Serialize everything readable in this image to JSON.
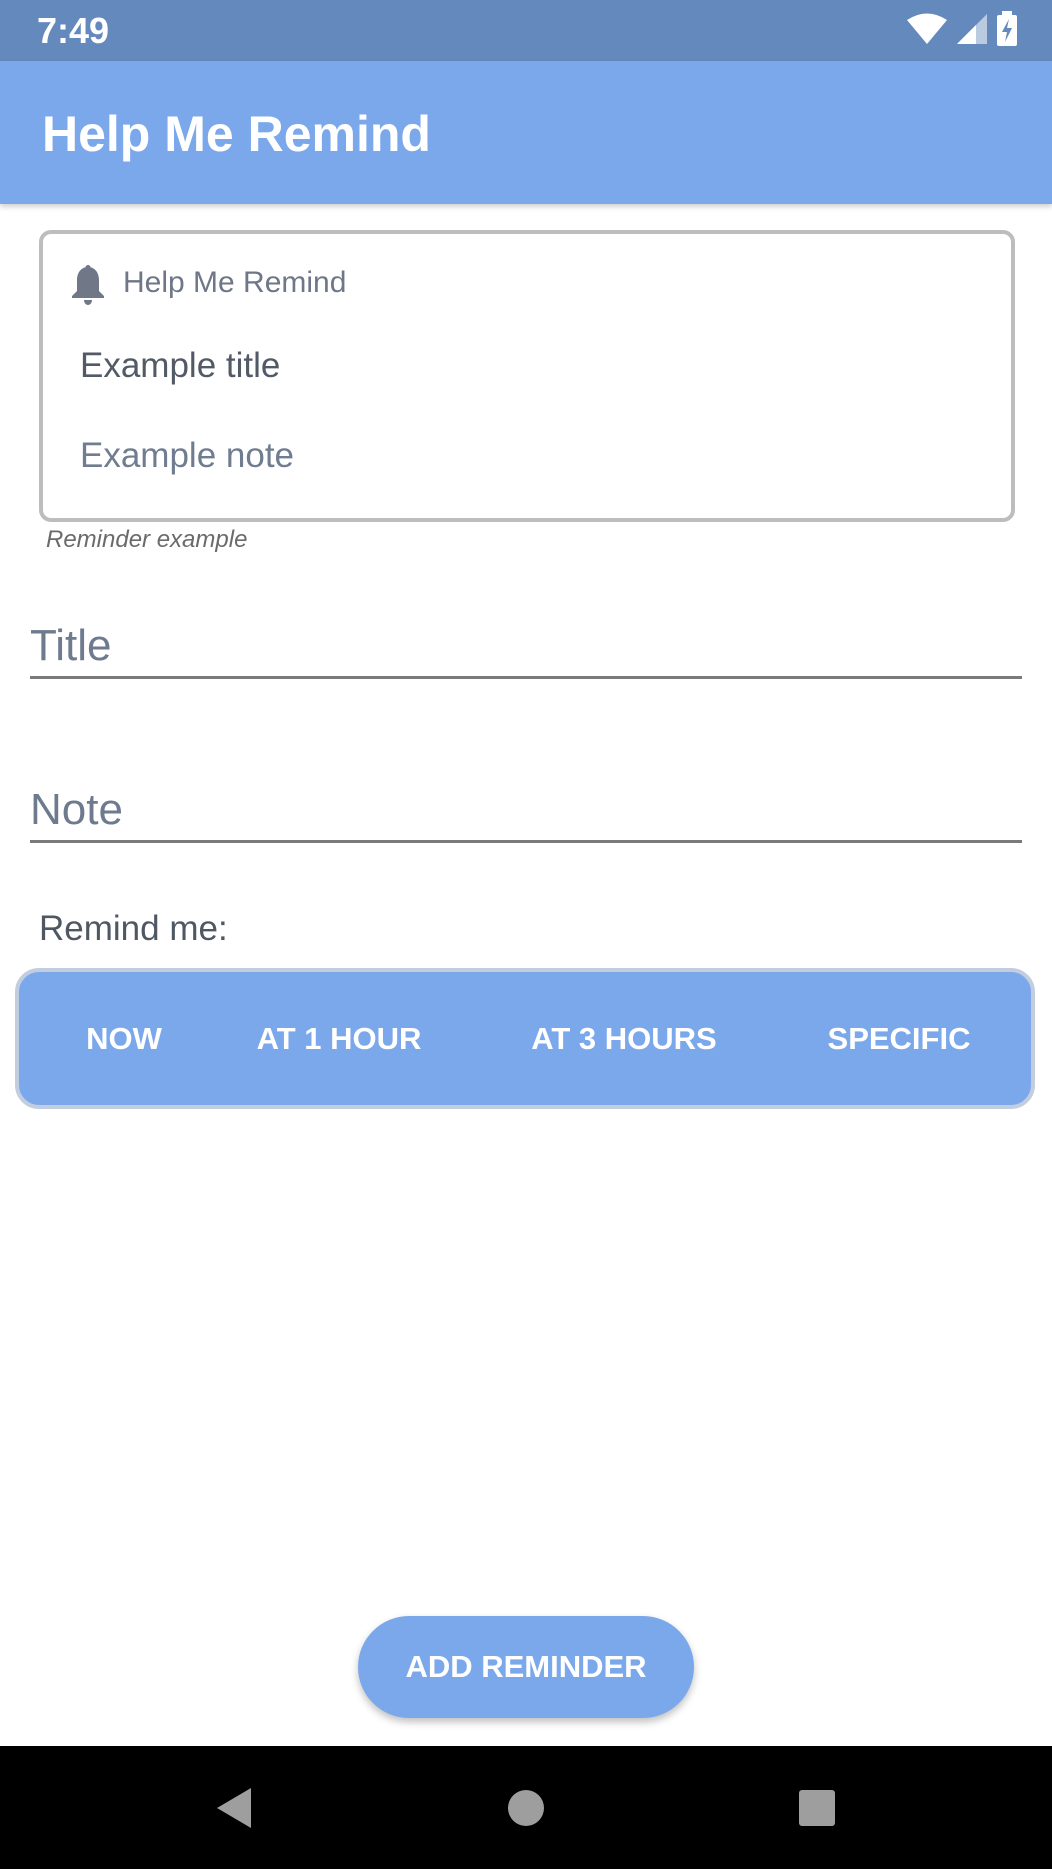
{
  "status_bar": {
    "time": "7:49",
    "icons": [
      "wifi-icon",
      "cell-signal-icon",
      "battery-charging-icon"
    ]
  },
  "app_bar": {
    "title": "Help Me Remind"
  },
  "example_card": {
    "icon": "bell-icon",
    "app_name": "Help Me Remind",
    "title": "Example title",
    "note": "Example note",
    "caption": "Reminder example"
  },
  "form": {
    "title_placeholder": "Title",
    "title_value": "",
    "note_placeholder": "Note",
    "note_value": "",
    "remind_label": "Remind me:"
  },
  "remind_options": [
    "NOW",
    "AT 1 HOUR",
    "AT 3 HOURS",
    "SPECIFIC"
  ],
  "add_button": {
    "label": "ADD REMINDER"
  },
  "nav_bar": {
    "icons": [
      "back-icon",
      "home-icon",
      "recents-icon"
    ]
  },
  "colors": {
    "status_bar": "#6489bd",
    "primary": "#7ba8ea",
    "nav_bar": "#000000"
  }
}
